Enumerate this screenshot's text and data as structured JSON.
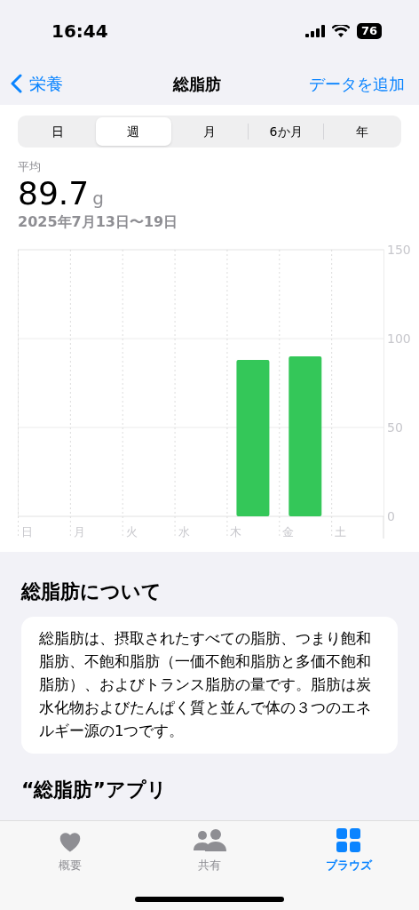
{
  "status_bar": {
    "time": "16:44",
    "battery": "76"
  },
  "nav": {
    "back": "栄養",
    "title": "総脂肪",
    "action": "データを追加"
  },
  "periods": [
    {
      "label": "日",
      "selected": false
    },
    {
      "label": "週",
      "selected": true
    },
    {
      "label": "月",
      "selected": false
    },
    {
      "label": "6か月",
      "selected": false
    },
    {
      "label": "年",
      "selected": false
    }
  ],
  "summary": {
    "label": "平均",
    "value": "89.7",
    "unit": "g",
    "range": "2025年7月13日〜19日"
  },
  "chart_data": {
    "type": "bar",
    "categories": [
      "日",
      "月",
      "火",
      "水",
      "木",
      "金",
      "土"
    ],
    "series": [
      {
        "color": "#34c759",
        "values": [
          null,
          null,
          null,
          null,
          88,
          90,
          null
        ]
      }
    ],
    "ylim": [
      0,
      150
    ],
    "yticks": [
      0,
      50,
      100,
      150
    ]
  },
  "about": {
    "heading": "総脂肪について",
    "text": "総脂肪は、摂取されたすべての脂肪、つまり飽和脂肪、不飽和脂肪（一価不飽和脂肪と多価不飽和脂肪）、およびトランス脂肪の量です。脂肪は炭水化物およびたんぱく質と並んで体の３つのエネルギー源の1つです。"
  },
  "apps_heading": "“総脂肪”アプリ",
  "tab_bar": [
    {
      "kind": "heart",
      "label": "概要",
      "selected": false
    },
    {
      "kind": "people",
      "label": "共有",
      "selected": false
    },
    {
      "kind": "grid",
      "label": "ブラウズ",
      "selected": true
    }
  ]
}
